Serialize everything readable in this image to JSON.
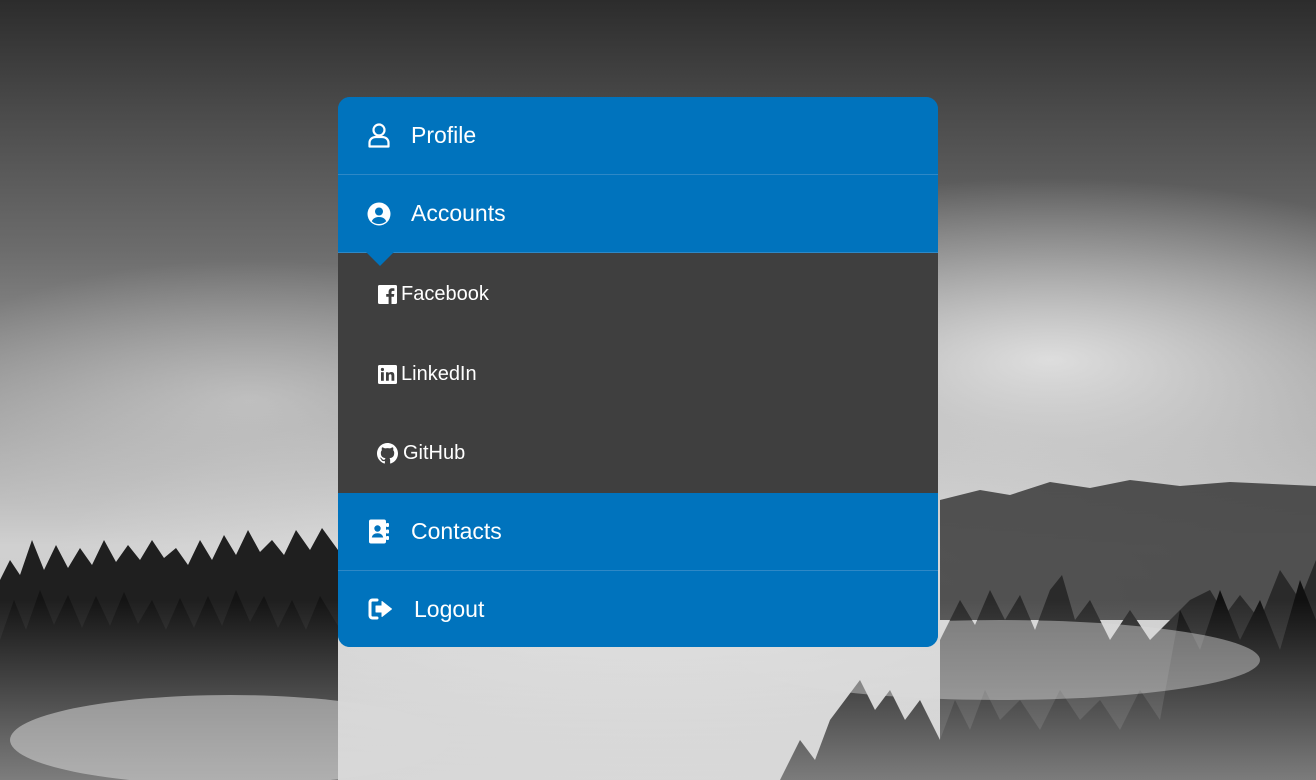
{
  "menu": {
    "items": [
      {
        "label": "Profile",
        "icon": "user-icon"
      },
      {
        "label": "Accounts",
        "icon": "user-circle-icon"
      },
      {
        "label": "Contacts",
        "icon": "address-book-icon"
      },
      {
        "label": "Logout",
        "icon": "sign-out-icon"
      }
    ],
    "accounts_submenu": [
      {
        "label": "Facebook",
        "icon": "facebook-icon"
      },
      {
        "label": "LinkedIn",
        "icon": "linkedin-icon"
      },
      {
        "label": "GitHub",
        "icon": "github-icon"
      }
    ]
  },
  "colors": {
    "menu_blue": "#0073bd",
    "submenu_dark": "#3f3f3f",
    "text": "#ffffff"
  }
}
